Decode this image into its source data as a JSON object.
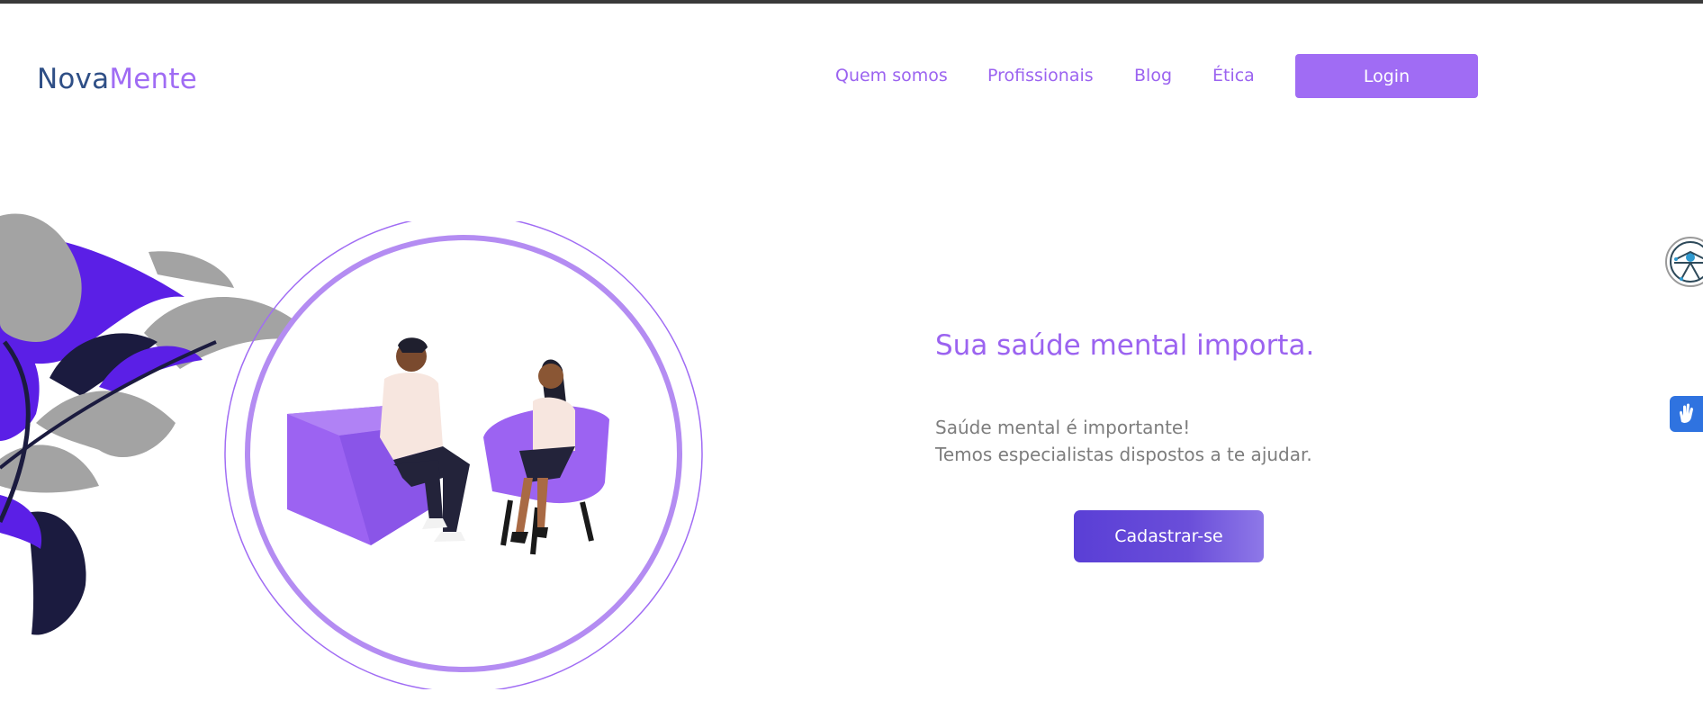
{
  "brand": {
    "name_part1": "Nova",
    "name_part2": "Mente"
  },
  "nav": {
    "items": [
      {
        "label": "Quem somos"
      },
      {
        "label": "Profissionais"
      },
      {
        "label": "Blog"
      },
      {
        "label": "Ética"
      }
    ],
    "login_label": "Login"
  },
  "hero": {
    "headline": "Sua saúde mental importa.",
    "description_line1": "Saúde mental é importante!",
    "description_line2": "Temos especialistas dispostos a te ajudar.",
    "cta_label": "Cadastrar-se"
  },
  "colors": {
    "accent": "#a06cf4",
    "brand_dark": "#2f4f86",
    "cta": "#5a3fd6",
    "plant_purple": "#5b1fe6",
    "plant_gray": "#a3a3a3",
    "plant_navy": "#1b1b3f"
  },
  "icons": {
    "accessibility": "accessibility-icon",
    "sign_language": "sign-language-hands-icon"
  }
}
